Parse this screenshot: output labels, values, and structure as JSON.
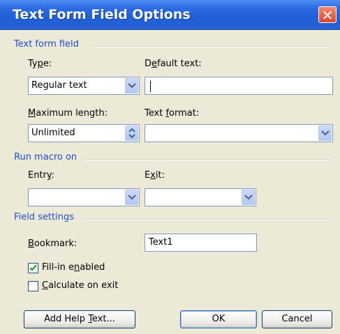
{
  "window": {
    "title": "Text Form Field Options",
    "close_glyph": "✕"
  },
  "text_form_field": {
    "group_label": "Text form field",
    "type_label": "Type:",
    "type_value": "Regular text",
    "default_text_label": "Default text:",
    "default_text_value": "",
    "max_length_label": "Maximum length:",
    "max_length_value": "Unlimited",
    "text_format_label": "Text format:",
    "text_format_value": ""
  },
  "run_macro": {
    "group_label": "Run macro on",
    "entry_label": "Entry:",
    "entry_value": "",
    "exit_label": "Exit:",
    "exit_value": ""
  },
  "field_settings": {
    "group_label": "Field settings",
    "bookmark_label": "Bookmark:",
    "bookmark_value": "Text1",
    "fill_in_label": "Fill-in enabled",
    "fill_in_checked": true,
    "calculate_label": "Calculate on exit",
    "calculate_checked": false
  },
  "buttons": {
    "help_label": "Add Help Text...",
    "ok_label": "OK",
    "cancel_label": "Cancel"
  },
  "colors": {
    "titlebar": "#2b6ae0",
    "group_text": "#1f4fc0",
    "dialog_bg": "#ece9d8"
  }
}
